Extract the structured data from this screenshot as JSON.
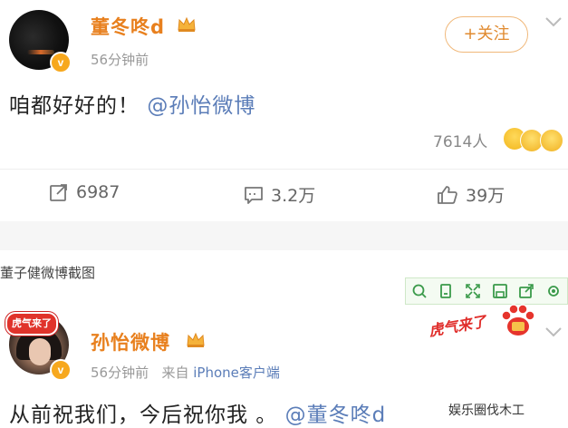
{
  "post1": {
    "username": "董冬咚d",
    "time": "56分钟前",
    "follow_label": "+关注",
    "content_text": "咱都好好的！",
    "content_mention": "@孙怡微博",
    "reaction_count": "7614人",
    "actions": {
      "repost": "6987",
      "comment": "3.2万",
      "like": "39万"
    }
  },
  "caption": "董子健微博截图",
  "post2": {
    "username": "孙怡微博",
    "time": "56分钟前",
    "source_prefix": "来自",
    "source": "iPhone客户端",
    "sticker_text": "虎气来了",
    "badge_text": "虎气来了",
    "content_text": "从前祝我们，今后祝你我 。",
    "content_mention": "@董冬咚d"
  },
  "watermark": "娱乐圈伐木工",
  "icons": {
    "verified": "v-badge-icon",
    "crown": "crown-icon",
    "chevron": "chevron-down-icon",
    "repost": "repost-icon",
    "comment": "comment-icon",
    "like": "thumbs-up-icon"
  },
  "colors": {
    "username": "#e8801e",
    "mention": "#5b7db8",
    "verified": "#f7a81e"
  }
}
